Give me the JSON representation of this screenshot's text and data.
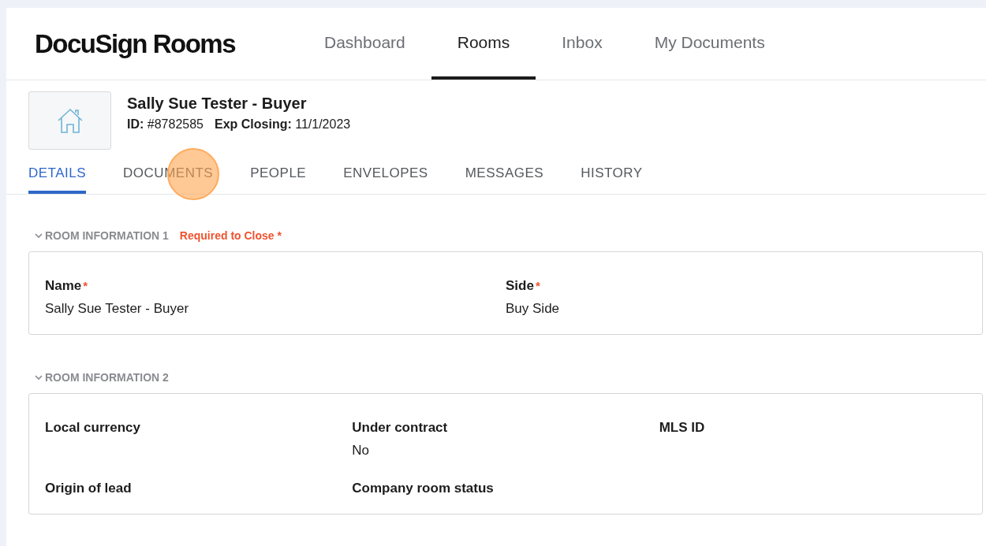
{
  "header": {
    "logo": "DocuSign Rooms",
    "nav": [
      {
        "label": "Dashboard",
        "selected": false
      },
      {
        "label": "Rooms",
        "selected": true
      },
      {
        "label": "Inbox",
        "selected": false
      },
      {
        "label": "My Documents",
        "selected": false
      }
    ]
  },
  "room": {
    "title": "Sally Sue Tester - Buyer",
    "id_label": "ID:",
    "id_value": "#8782585",
    "closing_label": "Exp Closing:",
    "closing_value": "11/1/2023"
  },
  "tabs": [
    {
      "label": "DETAILS",
      "selected": true
    },
    {
      "label": "DOCUMENTS",
      "selected": false
    },
    {
      "label": "PEOPLE",
      "selected": false
    },
    {
      "label": "ENVELOPES",
      "selected": false
    },
    {
      "label": "MESSAGES",
      "selected": false
    },
    {
      "label": "HISTORY",
      "selected": false
    }
  ],
  "sections": [
    {
      "title": "ROOM INFORMATION 1",
      "badge": "Required to Close *",
      "fields": [
        {
          "label": "Name",
          "required_mark": "*",
          "value": "Sally Sue Tester - Buyer"
        },
        {
          "label": "Side",
          "required_mark": "*",
          "value": "Buy Side"
        }
      ]
    },
    {
      "title": "ROOM INFORMATION 2",
      "fields": [
        {
          "label": "Local currency"
        },
        {
          "label": "Under contract",
          "value": "No"
        },
        {
          "label": "MLS ID"
        },
        {
          "label": "Origin of lead"
        },
        {
          "label": "Company room status"
        }
      ]
    }
  ]
}
